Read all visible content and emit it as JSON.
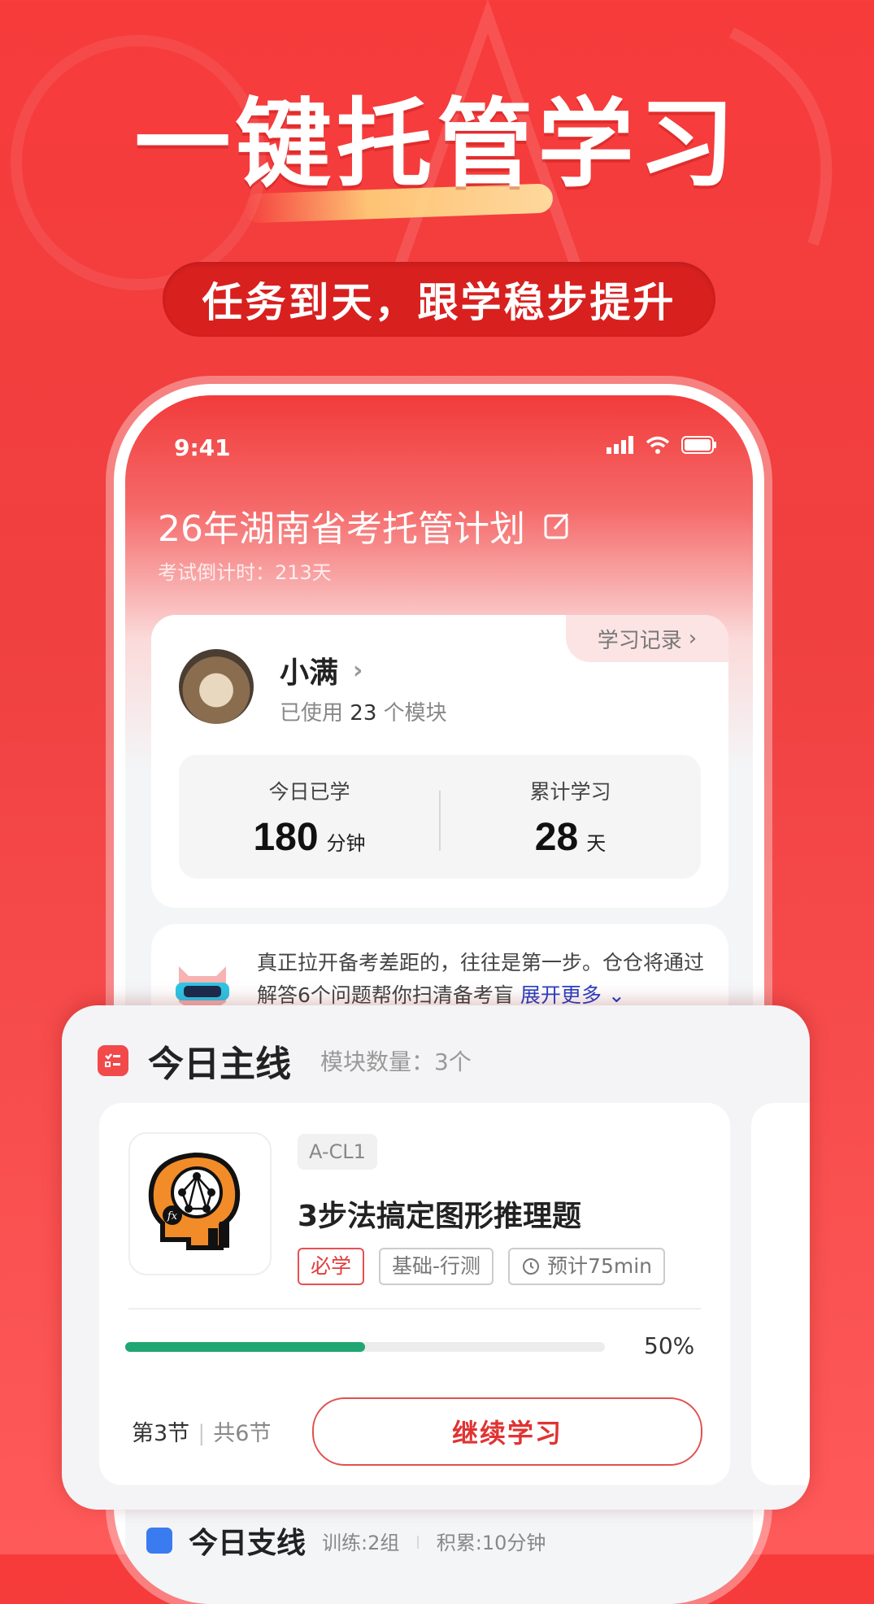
{
  "headline": "一键托管学习",
  "subtitle": "任务到天，跟学稳步提升",
  "status_bar": {
    "time": "9:41"
  },
  "plan": {
    "title": "26年湖南省考托管计划",
    "countdown": "考试倒计时：213天"
  },
  "user_card": {
    "record_link": "学习记录",
    "name": "小满",
    "module_prefix": "已使用",
    "module_count": "23",
    "module_suffix": "个模块",
    "stats": [
      {
        "label": "今日已学",
        "value": "180",
        "unit": "分钟"
      },
      {
        "label": "累计学习",
        "value": "28",
        "unit": "天"
      }
    ]
  },
  "tip": {
    "text": "真正拉开备考差距的，往往是第一步。仓仓将通过解答6个问题帮你扫清备考盲",
    "more": "展开更多"
  },
  "main": {
    "title": "今日主线",
    "count": "模块数量：3个",
    "course": {
      "code": "A-CL1",
      "title": "3步法搞定图形推理题",
      "tags": [
        "必学",
        "基础-行测",
        "预计75min"
      ],
      "progress": 0.5,
      "progress_label": "50%",
      "lesson_current": "第3节",
      "lesson_total": "共6节",
      "continue_label": "继续学习"
    }
  },
  "side": {
    "title": "今日支线",
    "train": "训练:2组",
    "accum": "积累:10分钟"
  },
  "colors": {
    "brand_red": "#f23b3b",
    "progress_green": "#1fa672",
    "link_blue": "#2a3fc4"
  }
}
